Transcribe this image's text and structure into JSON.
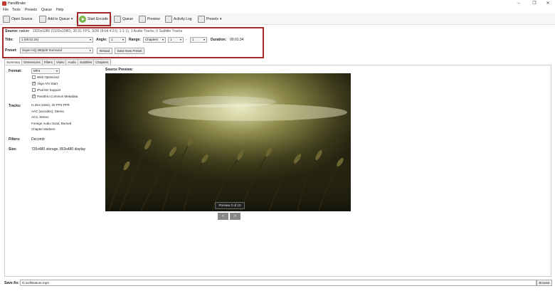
{
  "window": {
    "title": "HandBrake",
    "minimize": "–",
    "maximize": "❐",
    "close": "✕"
  },
  "menu": [
    "File",
    "Tools",
    "Presets",
    "Queue",
    "Help"
  ],
  "toolbar": {
    "open_source": "Open Source",
    "add_to_queue": "Add to Queue",
    "start_encode": "Start Encode",
    "queue": "Queue",
    "preview": "Preview",
    "activity_log": "Activity Log",
    "presets": "Presets"
  },
  "source": {
    "label": "Source:",
    "name": "nature",
    "details": "1920x1080 (1920x1080), 30.01 FPS, SDR (8-bit 4:2:0, 1-1-1), 1 Audio Tracks, 0 Subtitle Tracks"
  },
  "title_row": {
    "title_label": "Title:",
    "title_value": "1 (00:01:34)",
    "angle_label": "Angle:",
    "angle_value": "1",
    "range_label": "Range:",
    "range_type": "Chapters",
    "range_start": "1",
    "range_sep": "-",
    "range_end": "1",
    "duration_label": "Duration:",
    "duration_value": "00:01:34"
  },
  "preset_row": {
    "label": "Preset:",
    "value": "Super HQ 480p30 Surround",
    "reload": "Reload",
    "save_new": "Save New Preset"
  },
  "tabs": [
    "Summary",
    "Dimensions",
    "Filters",
    "Video",
    "Audio",
    "Subtitles",
    "Chapters"
  ],
  "summary": {
    "format_label": "Format:",
    "format_value": "MP4",
    "options": [
      {
        "label": "Web Optimized",
        "checked": false
      },
      {
        "label": "Align A/V Start",
        "checked": true
      },
      {
        "label": "iPod 5G Support",
        "checked": false
      },
      {
        "label": "Passthru Common Metadata",
        "checked": true
      }
    ],
    "tracks_label": "Tracks:",
    "tracks": [
      "H.264 (x264), 30 FPS PFR",
      "AAC (avcodec), Stereo",
      "AC3, Stereo",
      "Foreign Audio Scan, Burned",
      "Chapter Markers"
    ],
    "filters_label": "Filters:",
    "filters_value": "Decomb",
    "size_label": "Size:",
    "size_value": "720x480 storage, 853x480 display"
  },
  "preview": {
    "heading": "Source Preview:",
    "badge": "Preview 2 of 10",
    "prev": "<",
    "next": ">"
  },
  "save": {
    "label": "Save As:",
    "path": "D:\\soft\\Nature.mp4",
    "browse": "Browse"
  },
  "colors": {
    "highlight": "#a52a2a",
    "play": "#7ab648"
  }
}
